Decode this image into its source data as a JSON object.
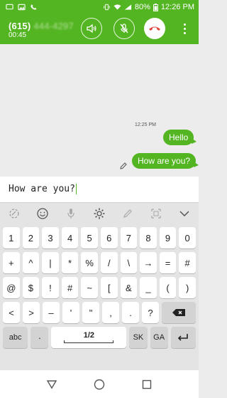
{
  "status_bar": {
    "battery": "80%",
    "time": "12:26 PM"
  },
  "call": {
    "caller_prefix": "(615)",
    "caller_rest": "444-4297",
    "duration": "00:45"
  },
  "conversation": {
    "timestamp": "12:25 PM",
    "messages": [
      {
        "text": "Hello"
      },
      {
        "text": "How are you?"
      }
    ]
  },
  "input": {
    "value": "How are you?"
  },
  "keyboard": {
    "rows": [
      [
        "1",
        "2",
        "3",
        "4",
        "5",
        "6",
        "7",
        "8",
        "9",
        "0"
      ],
      [
        "+",
        "^",
        "|",
        "*",
        "%",
        "/",
        "\\",
        "→",
        "=",
        "#"
      ],
      [
        "@",
        "$",
        "!",
        "#",
        "~",
        "[",
        "&",
        "_",
        "(",
        ")"
      ],
      [
        "<",
        ">",
        "–",
        "'",
        "\"",
        ",",
        ".",
        "?",
        "⌫"
      ],
      [
        "abc",
        "·",
        "1/2",
        "SK",
        "GA",
        "↵"
      ]
    ]
  },
  "colors": {
    "accent": "#53b521",
    "end_call": "#e0453a"
  }
}
